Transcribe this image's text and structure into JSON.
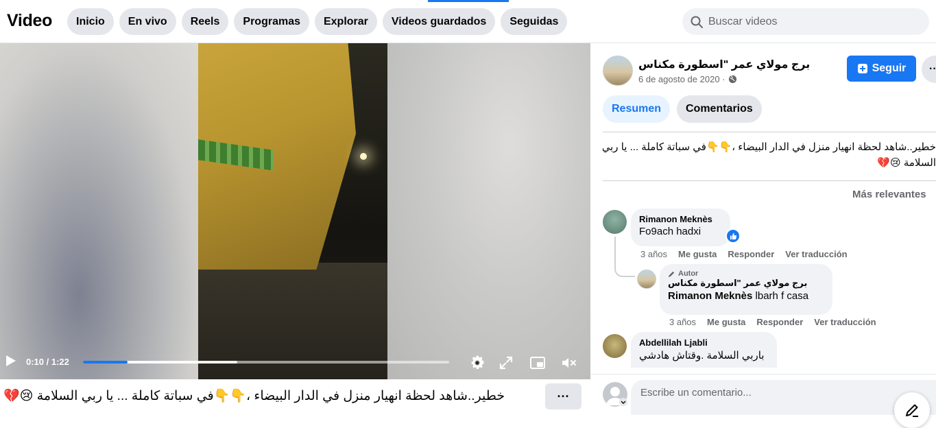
{
  "header": {
    "title": "Video",
    "nav": [
      "Inicio",
      "En vivo",
      "Reels",
      "Programas",
      "Explorar",
      "Videos guardados",
      "Seguidas"
    ],
    "search_placeholder": "Buscar videos"
  },
  "player": {
    "time": "0:10 / 1:22",
    "progress_fraction": 0.122,
    "buffered_fraction": 0.422
  },
  "caption": {
    "text": "خطير..شاهد لحظة انهيار منزل في الدار البيضاء ،👇👇في سباتة كاملة ... يا ربي السلامة 😢💔",
    "more": "···"
  },
  "post": {
    "page_name": "برج مولاي عمر \"اسطورة مكناس",
    "date": "6 de agosto de 2020 ·",
    "follow_label": "Seguir",
    "more": "···",
    "tabs": [
      "Resumen",
      "Comentarios"
    ],
    "description_line1": "خطير..شاهد لحظة انهيار منزل في الدار البيضاء ،👇👇في سباتة كاملة ... يا ربي",
    "description_line2": "السلامة 😢💔",
    "sort_label": "Más relevantes"
  },
  "comments": [
    {
      "author": "Rimanon Meknès",
      "text": "Fo9ach hadxi",
      "age": "3 años",
      "like": "Me gusta",
      "reply": "Responder",
      "translate": "Ver traducción"
    },
    {
      "badge": "Autor",
      "author": "برج مولاي عمر \"اسطورة مكناس",
      "mention": "Rimanon Meknès",
      "text": " lbarh f casa",
      "age": "3 años",
      "like": "Me gusta",
      "reply": "Responder",
      "translate": "Ver traducción"
    },
    {
      "author": "Abdellilah Ljabli",
      "text": "باربي السلامة .وقتاش هادشي"
    }
  ],
  "composer": {
    "placeholder": "Escribe un comentario..."
  },
  "colors": {
    "accent": "#1877f2",
    "pill": "#e4e6eb",
    "muted_text": "#65676b"
  }
}
